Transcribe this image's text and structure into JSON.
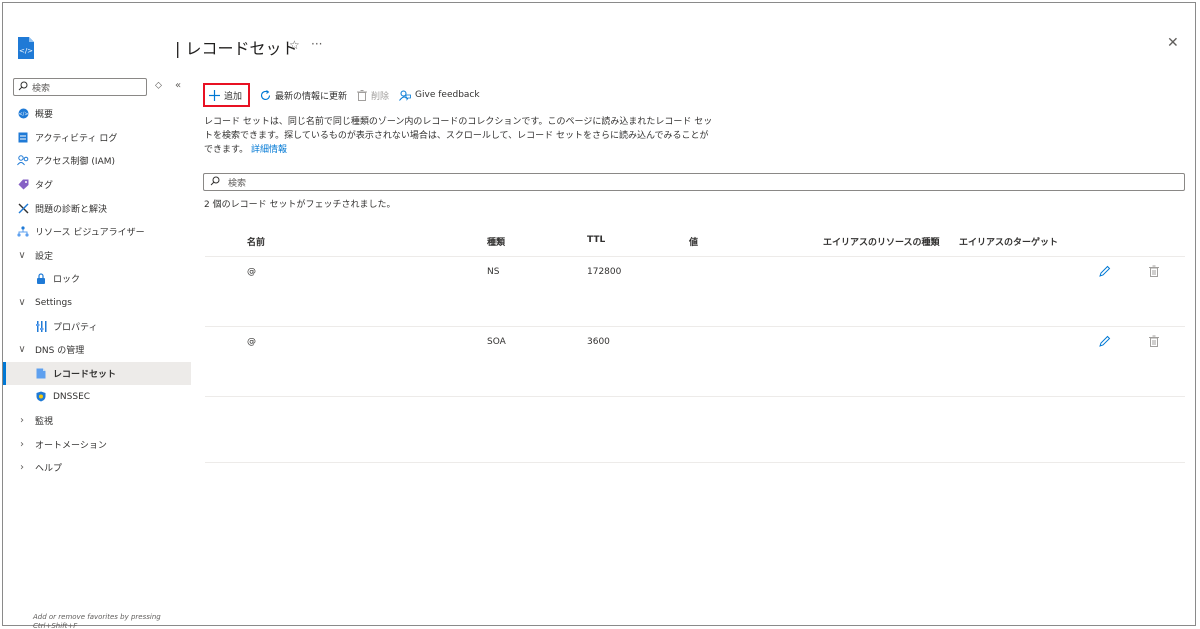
{
  "header": {
    "title": "レコードセット"
  },
  "sidebar": {
    "search_placeholder": "検索",
    "items": [
      {
        "label": "概要"
      },
      {
        "label": "アクティビティ ログ"
      },
      {
        "label": "アクセス制御 (IAM)"
      },
      {
        "label": "タグ"
      },
      {
        "label": "問題の診断と解決"
      },
      {
        "label": "リソース ビジュアライザー"
      },
      {
        "label": "設定"
      },
      {
        "label": "ロック"
      },
      {
        "label": "Settings"
      },
      {
        "label": "プロパティ"
      },
      {
        "label": "DNS の管理"
      },
      {
        "label": "レコードセット"
      },
      {
        "label": "DNSSEC"
      },
      {
        "label": "監視"
      },
      {
        "label": "オートメーション"
      },
      {
        "label": "ヘルプ"
      }
    ],
    "footer": "Add or remove favorites by pressing Ctrl+Shift+F"
  },
  "toolbar": {
    "add_label": "追加",
    "refresh_label": "最新の情報に更新",
    "delete_label": "削除",
    "feedback_label": "Give feedback"
  },
  "description": {
    "text": "レコード セットは、同じ名前で同じ種類のゾーン内のレコードのコレクションです。このページに読み込まれたレコード セットを検索できます。探しているものが表示されない場合は、スクロールして、レコード セットをさらに読み込んでみることができます。",
    "link": "詳細情報"
  },
  "search": {
    "placeholder": "検索"
  },
  "count_text": "2 個のレコード セットがフェッチされました。",
  "table": {
    "headers": [
      "名前",
      "種類",
      "TTL",
      "値",
      "エイリアスのリソースの種類",
      "エイリアスのターゲット"
    ],
    "rows": [
      {
        "name": "@",
        "type": "NS",
        "ttl": "172800",
        "value": ""
      },
      {
        "name": "@",
        "type": "SOA",
        "ttl": "3600",
        "value": ""
      }
    ]
  },
  "colors": {
    "accent": "#0078d4",
    "highlight_border": "#e81123"
  }
}
